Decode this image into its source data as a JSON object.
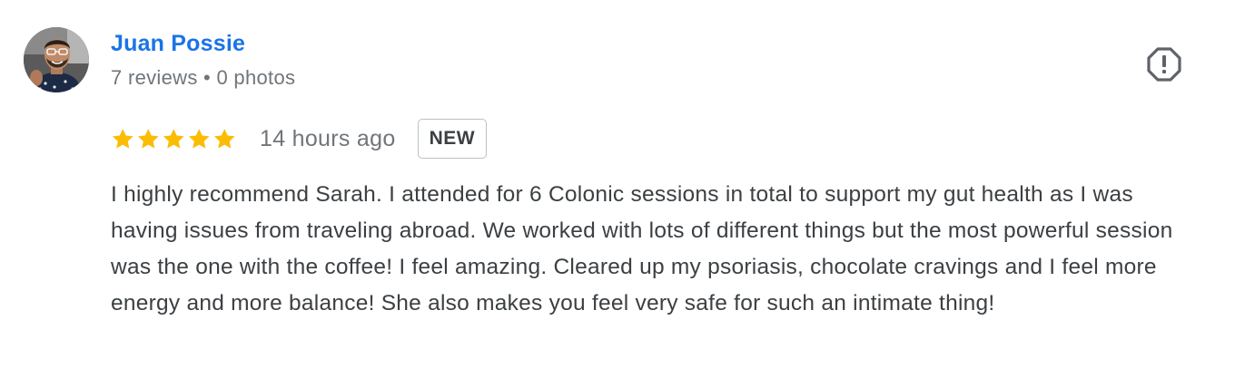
{
  "review": {
    "author": {
      "name": "Juan Possie",
      "reviews_count": "7 reviews",
      "separator": "•",
      "photos_count": "0 photos",
      "avatar_icon": "user-photo-avatar"
    },
    "rating": {
      "stars": 5,
      "max_stars": 5,
      "star_color": "#fbbc04"
    },
    "time": "14 hours ago",
    "badge": "NEW",
    "text": "I highly recommend Sarah. I attended for 6 Colonic sessions in total to support my gut health as I was having issues from traveling abroad. We worked with lots of different things but the most powerful session was the one with the coffee! I feel amazing. Cleared up my psoriasis, chocolate cravings and I feel more energy and more balance! She also makes you feel very safe for such an intimate thing!",
    "report_icon": "report-octagon-icon"
  },
  "colors": {
    "link": "#1a73e8",
    "secondary_text": "#70757a",
    "body_text": "#3c4043",
    "badge_border": "#bdc1c6"
  }
}
